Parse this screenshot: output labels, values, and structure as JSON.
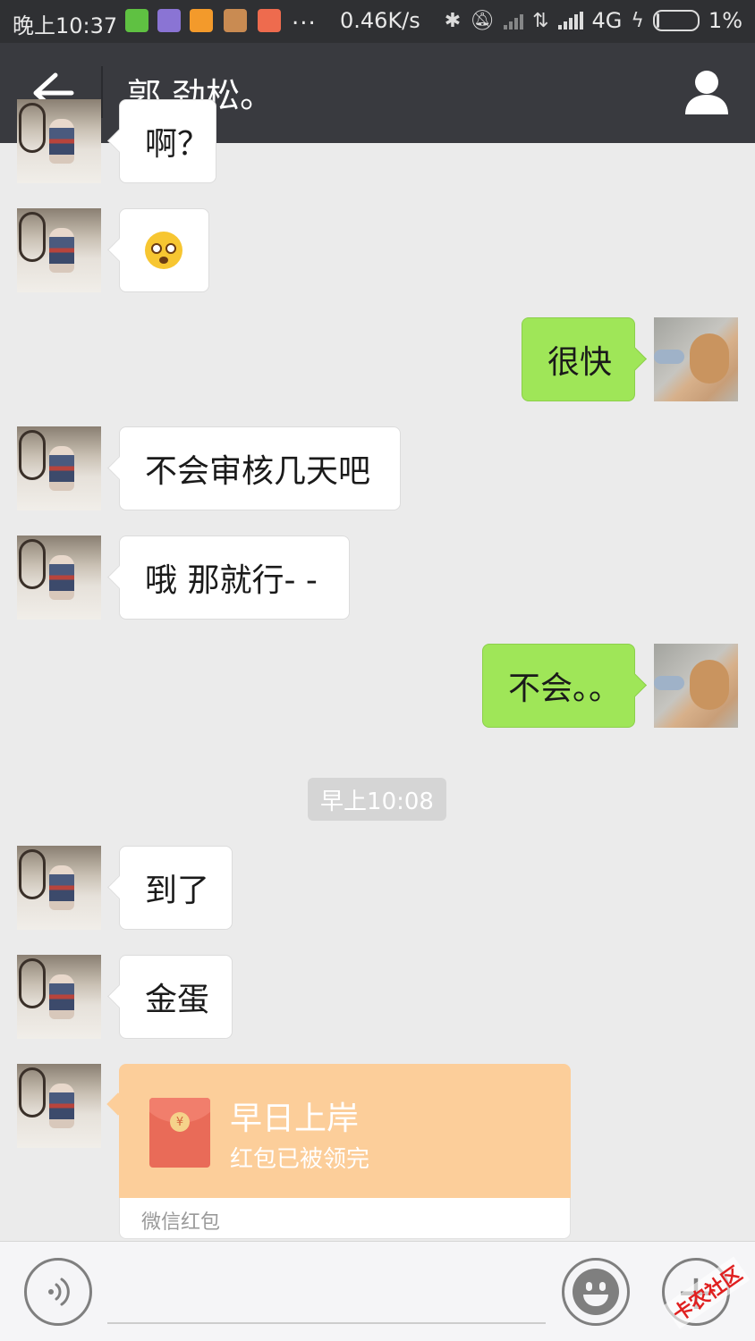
{
  "status_bar": {
    "time": "晚上10:37",
    "more": "...",
    "speed": "0.46K/s",
    "network": "4G",
    "battery": "1%",
    "app_icon_colors": [
      "#5fc142",
      "#8a74d4",
      "#f39a2b",
      "#c98b52",
      "#ee6b4e"
    ]
  },
  "header": {
    "title": "郭 劲松。"
  },
  "messages": [
    {
      "side": "left",
      "text": "啊？"
    },
    {
      "side": "left",
      "emoji": "astonished-face"
    },
    {
      "side": "right",
      "text": "很快"
    },
    {
      "side": "left",
      "text": "不会审核几天吧"
    },
    {
      "side": "left",
      "text": "哦 那就行- -"
    },
    {
      "side": "right",
      "text": "不会。。"
    },
    {
      "timestamp": "早上10:08"
    },
    {
      "side": "left",
      "text": "到了"
    },
    {
      "side": "left",
      "text": "金蛋"
    },
    {
      "side": "left",
      "red_packet": {
        "title": "早日上岸",
        "status": "红包已被领完",
        "source": "微信红包",
        "coin_symbol": "¥"
      }
    }
  ],
  "watermark": "卡农社区",
  "colors": {
    "titlebar": "#393a3f",
    "sent_bubble": "#9fe658",
    "red_packet": "#fcce9a",
    "background": "#ebebeb"
  }
}
